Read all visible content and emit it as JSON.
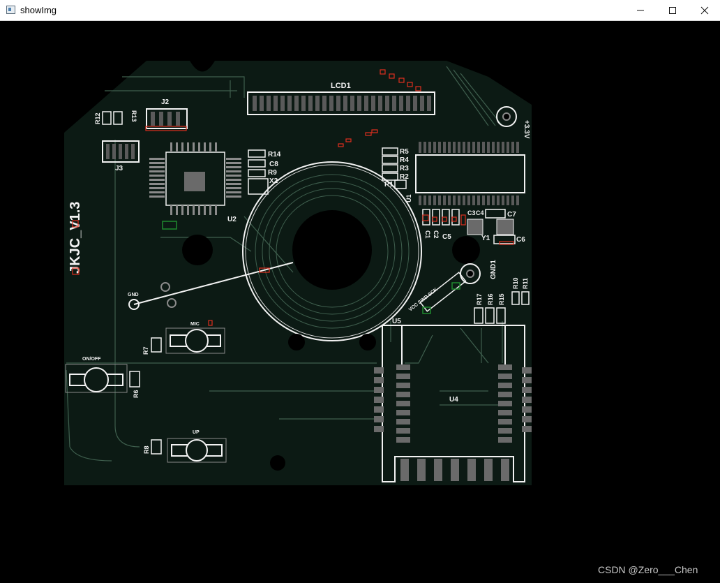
{
  "window": {
    "title": "showImg",
    "icon": "app-window-icon",
    "controls": [
      "minimize-icon",
      "maximize-icon",
      "close-icon"
    ]
  },
  "board": {
    "version_label": "JKJC_V1.3",
    "labels": {
      "lcd": "LCD1",
      "j2": "J2",
      "j3": "J3",
      "u2": "U2",
      "u1": "U1",
      "u4": "U4",
      "u5": "U5",
      "y1": "Y1",
      "x2": "X2",
      "power": "+3.3V",
      "gnd1": "GND1",
      "gnd": "GND",
      "swd": "VCC SWD SCK",
      "mic": "MIC",
      "onoff": "ON/OFF",
      "up": "UP",
      "r12": "R12",
      "r13": "R13",
      "r14": "R14",
      "c8": "C8",
      "r9": "R9",
      "r5": "R5",
      "r4": "R4",
      "r3": "R3",
      "r2": "R2",
      "r1": "R1",
      "c7": "C7",
      "c6": "C6",
      "c1": "C1",
      "c2": "C2",
      "c5": "C5",
      "c3": "C3",
      "c4": "C4",
      "r17": "R17",
      "r16": "R16",
      "r15": "R15",
      "r10": "R10",
      "r11": "R11",
      "r7": "R7",
      "r6": "R6",
      "r8": "R8"
    },
    "colors": {
      "substrate": "#0c1a14",
      "trace": "#3f5f4e",
      "silk": "#f2f2f2",
      "marker_red": "#e0301e",
      "marker_green": "#1f8a2e"
    }
  },
  "watermark": "CSDN @Zero___Chen"
}
